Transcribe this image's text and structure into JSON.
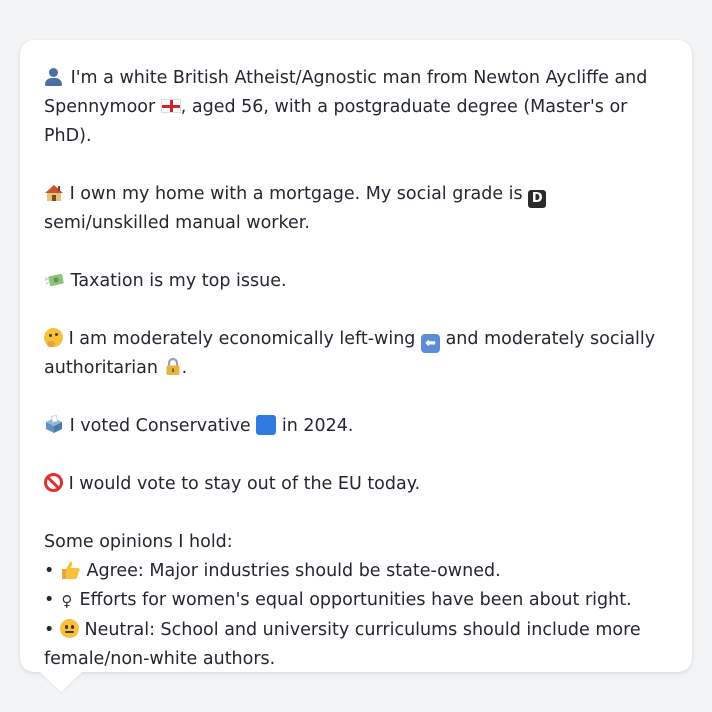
{
  "profile": {
    "p1": {
      "icon": "person-silhouette-icon",
      "text_a": "I'm a white British Atheist/Agnostic man from Newton Aycliffe and Spennymoor",
      "flag_icon": "england-flag-icon",
      "text_b": ", aged 56, with a postgraduate degree (Master's or PhD)."
    },
    "p2": {
      "icon": "house-icon",
      "text_a": "I own my home with a mortgage. My social grade is",
      "grade_icon": "letter-d-icon",
      "grade_letter": "D",
      "text_b": "semi/unskilled manual worker."
    },
    "p3": {
      "icon": "money-with-wings-icon",
      "text": "Taxation is my top issue."
    },
    "p4": {
      "icon": "thinking-face-icon",
      "text_a": "I am moderately economically left-wing",
      "arrow_icon": "left-arrow-icon",
      "arrow_glyph": "⬅",
      "text_b": "and moderately socially authoritarian",
      "lock_icon": "lock-icon",
      "text_c": "."
    },
    "p5": {
      "icon": "ballot-box-icon",
      "text_a": "I voted Conservative",
      "party_icon": "blue-square-icon",
      "text_b": "in 2024."
    },
    "p6": {
      "icon": "no-entry-icon",
      "text": "I would vote to stay out of the EU today."
    },
    "opinions_heading": "Some opinions I hold:",
    "opinions": [
      {
        "bullet": "•",
        "icon": "thumbs-up-icon",
        "text": "Agree: Major industries should be state-owned."
      },
      {
        "bullet": "•",
        "icon": "female-sign-icon",
        "glyph": "♀",
        "text": "Efforts for women's equal opportunities have been about right."
      },
      {
        "bullet": "•",
        "icon": "neutral-face-icon",
        "text": "Neutral: School and university curriculums should include more female/non-white authors."
      }
    ]
  },
  "colors": {
    "background": "#f3f4f6",
    "bubble": "#ffffff",
    "text": "#23272f"
  }
}
